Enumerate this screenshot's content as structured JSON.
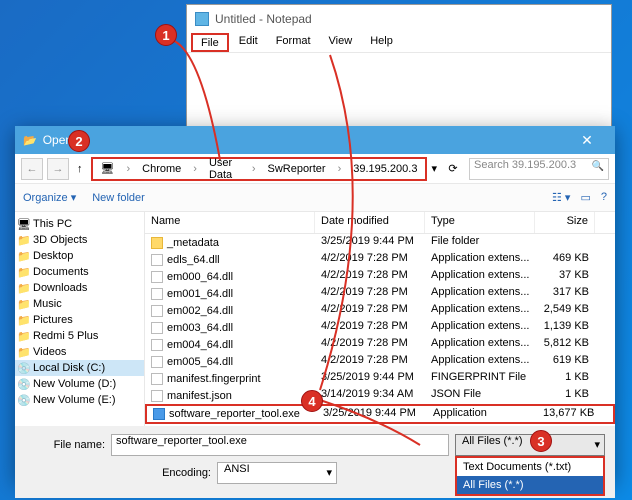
{
  "notepad": {
    "title": "Untitled - Notepad",
    "menu": {
      "file": "File",
      "edit": "Edit",
      "format": "Format",
      "view": "View",
      "help": "Help"
    }
  },
  "open": {
    "title": "Open",
    "crumbs": [
      "Chrome",
      "User Data",
      "SwReporter",
      "39.195.200.3"
    ],
    "search_placeholder": "Search 39.195.200.3",
    "toolbar": {
      "organize": "Organize ▾",
      "newfolder": "New folder"
    },
    "headers": {
      "name": "Name",
      "date": "Date modified",
      "type": "Type",
      "size": "Size"
    },
    "tree": [
      "This PC",
      "3D Objects",
      "Desktop",
      "Documents",
      "Downloads",
      "Music",
      "Pictures",
      "Redmi 5 Plus",
      "Videos",
      "Local Disk (C:)",
      "New Volume (D:)",
      "New Volume (E:)"
    ],
    "files": [
      {
        "n": "_metadata",
        "d": "3/25/2019 9:44 PM",
        "t": "File folder",
        "s": "",
        "k": "folder"
      },
      {
        "n": "edls_64.dll",
        "d": "4/2/2019 7:28 PM",
        "t": "Application extens...",
        "s": "469 KB",
        "k": "file"
      },
      {
        "n": "em000_64.dll",
        "d": "4/2/2019 7:28 PM",
        "t": "Application extens...",
        "s": "37 KB",
        "k": "file"
      },
      {
        "n": "em001_64.dll",
        "d": "4/2/2019 7:28 PM",
        "t": "Application extens...",
        "s": "317 KB",
        "k": "file"
      },
      {
        "n": "em002_64.dll",
        "d": "4/2/2019 7:28 PM",
        "t": "Application extens...",
        "s": "2,549 KB",
        "k": "file"
      },
      {
        "n": "em003_64.dll",
        "d": "4/2/2019 7:28 PM",
        "t": "Application extens...",
        "s": "1,139 KB",
        "k": "file"
      },
      {
        "n": "em004_64.dll",
        "d": "4/2/2019 7:28 PM",
        "t": "Application extens...",
        "s": "5,812 KB",
        "k": "file"
      },
      {
        "n": "em005_64.dll",
        "d": "4/2/2019 7:28 PM",
        "t": "Application extens...",
        "s": "619 KB",
        "k": "file"
      },
      {
        "n": "manifest.fingerprint",
        "d": "3/25/2019 9:44 PM",
        "t": "FINGERPRINT File",
        "s": "1 KB",
        "k": "file"
      },
      {
        "n": "manifest.json",
        "d": "3/14/2019 9:34 AM",
        "t": "JSON File",
        "s": "1 KB",
        "k": "file"
      },
      {
        "n": "software_reporter_tool.exe",
        "d": "3/25/2019 9:44 PM",
        "t": "Application",
        "s": "13,677 KB",
        "k": "exe",
        "sel": true
      }
    ],
    "fn_label": "File name:",
    "fn_value": "software_reporter_tool.exe",
    "filter": "All Files (*.*)",
    "filter_opts": [
      "Text Documents (*.txt)",
      "All Files (*.*)"
    ],
    "enc_label": "Encoding:",
    "enc_value": "ANSI"
  },
  "badges": {
    "1": "1",
    "2": "2",
    "3": "3",
    "4": "4"
  }
}
